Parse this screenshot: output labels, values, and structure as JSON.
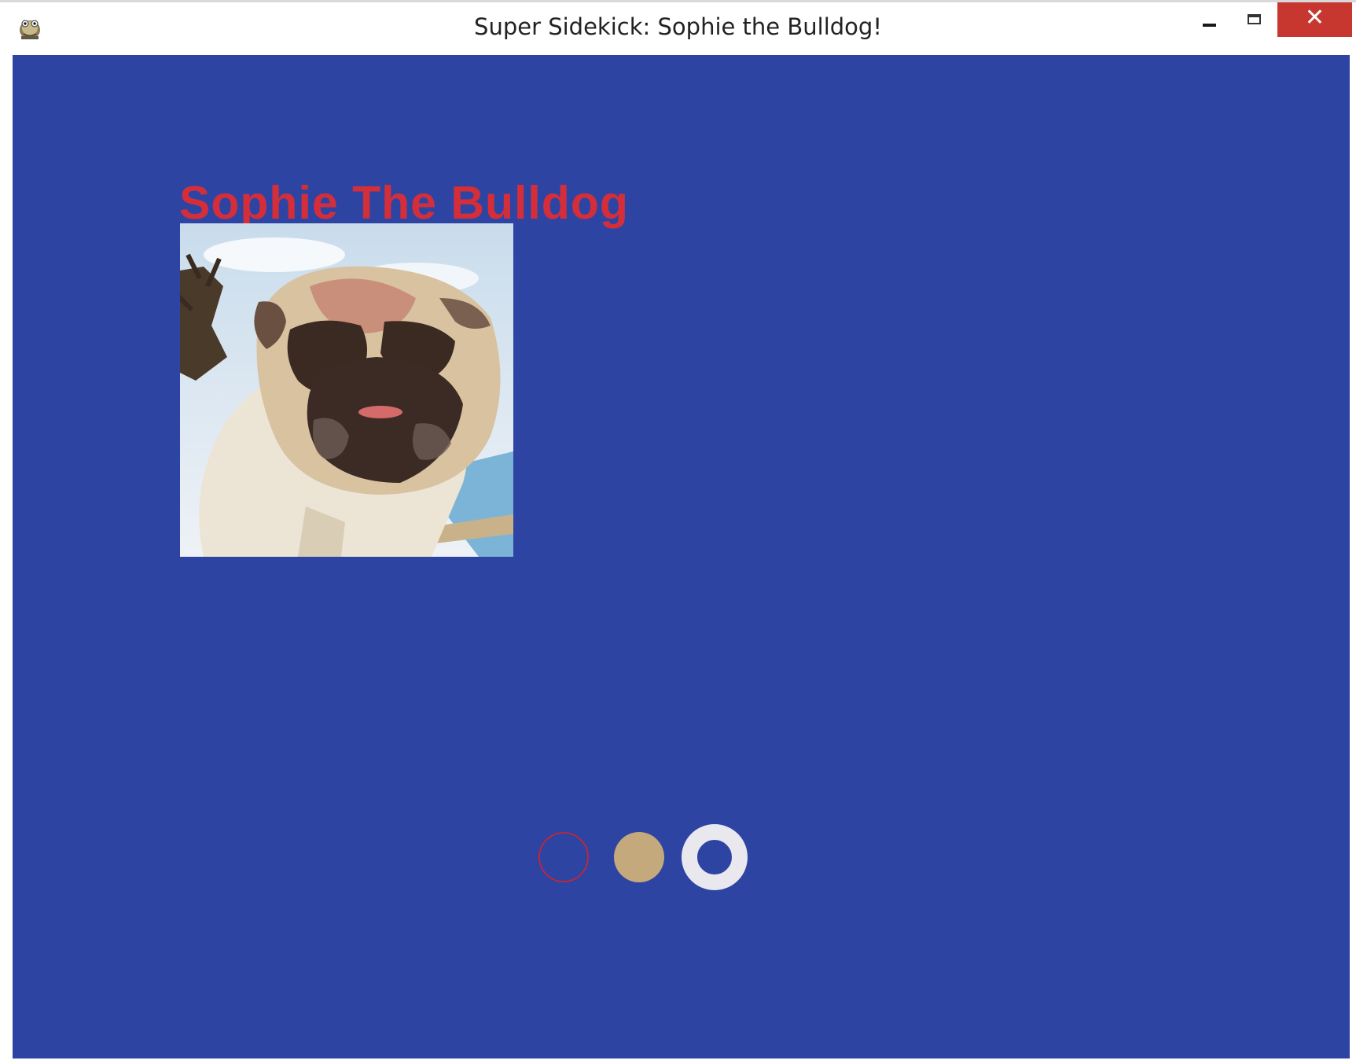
{
  "window": {
    "title": "Super Sidekick: Sophie the Bulldog!",
    "app_icon": "pygame-snake-icon",
    "controls": {
      "minimize_icon": "minimize-icon",
      "maximize_icon": "maximize-icon",
      "close_icon": "close-icon",
      "close_color": "#c7372f"
    }
  },
  "scene": {
    "background_color": "#2e44a3",
    "heading": "Sophie The Bulldog",
    "heading_color": "#d42e3a",
    "photo": "bulldog-photo",
    "shapes": [
      {
        "kind": "outline-circle",
        "color": "#e02020"
      },
      {
        "kind": "filled-circle",
        "color": "#c4a97c"
      },
      {
        "kind": "ring",
        "color": "#e8e8ee"
      }
    ]
  }
}
